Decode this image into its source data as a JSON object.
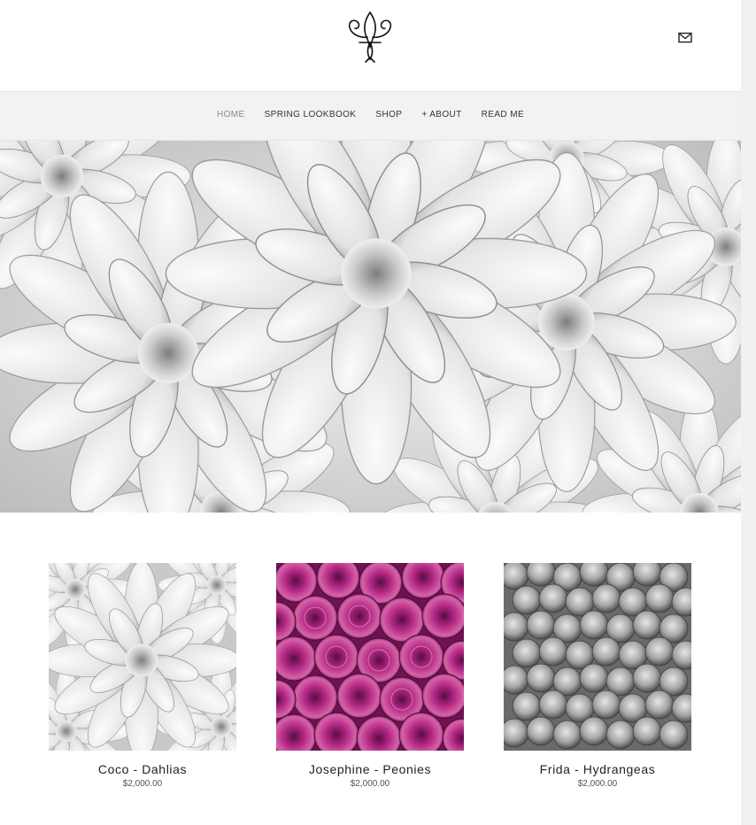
{
  "header": {
    "logo": "fleur-de-lis-logo",
    "mail_icon": "envelope-icon"
  },
  "nav": {
    "items": [
      {
        "label": "HOME",
        "active": true
      },
      {
        "label": "SPRING LOOKBOOK",
        "active": false
      },
      {
        "label": "SHOP",
        "active": false
      },
      {
        "label": "+ ABOUT",
        "active": false
      },
      {
        "label": "READ ME",
        "active": false
      }
    ]
  },
  "hero": {
    "image": "white-dahlias-banner"
  },
  "products": [
    {
      "name": "Coco - Dahlias",
      "price": "$2,000.00",
      "image": "white-dahlias",
      "tone": "#d8d8d8"
    },
    {
      "name": "Josephine - Peonies",
      "price": "$2,000.00",
      "image": "magenta-peonies",
      "tone": "#9b1a72"
    },
    {
      "name": "Frida - Hydrangeas",
      "price": "$2,000.00",
      "image": "grey-hydrangeas",
      "tone": "#9a9a9a"
    }
  ]
}
